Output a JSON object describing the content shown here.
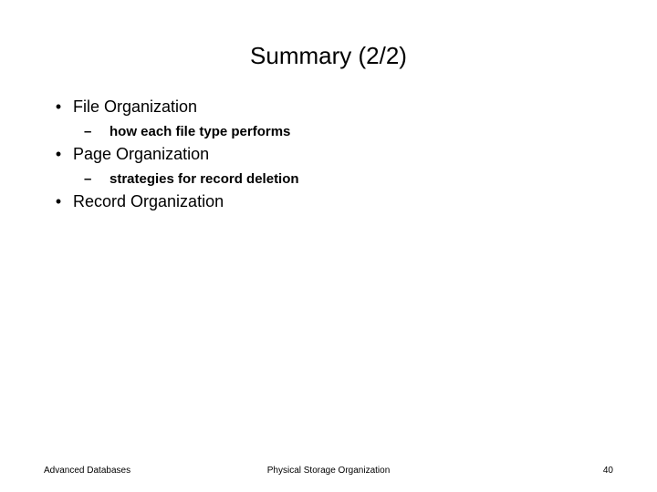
{
  "title": "Summary (2/2)",
  "bullets": [
    {
      "text": "File Organization",
      "sub": [
        {
          "text": "how each file type performs"
        }
      ]
    },
    {
      "text": "Page Organization",
      "sub": [
        {
          "text": "strategies for record deletion"
        }
      ]
    },
    {
      "text": "Record Organization",
      "sub": []
    }
  ],
  "footer": {
    "left": "Advanced Databases",
    "center": "Physical Storage Organization",
    "right": "40"
  }
}
